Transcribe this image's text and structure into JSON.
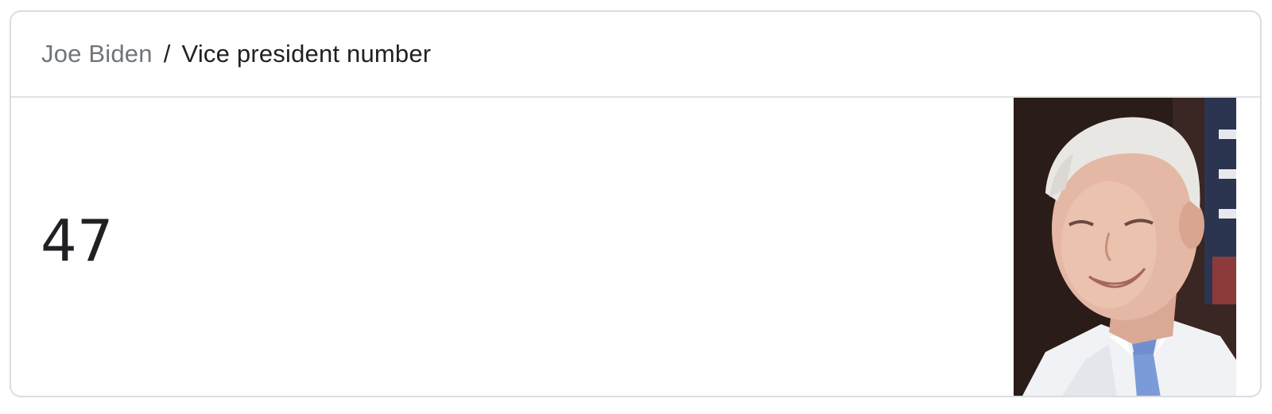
{
  "breadcrumb": {
    "entity": "Joe Biden",
    "separator": "/",
    "attribute": "Vice president number"
  },
  "answer": {
    "value": "47"
  },
  "photo": {
    "subject": "Joe Biden portrait"
  },
  "colors": {
    "entity_text": "#70757a",
    "primary_text": "#202124",
    "border": "#dadce0"
  }
}
